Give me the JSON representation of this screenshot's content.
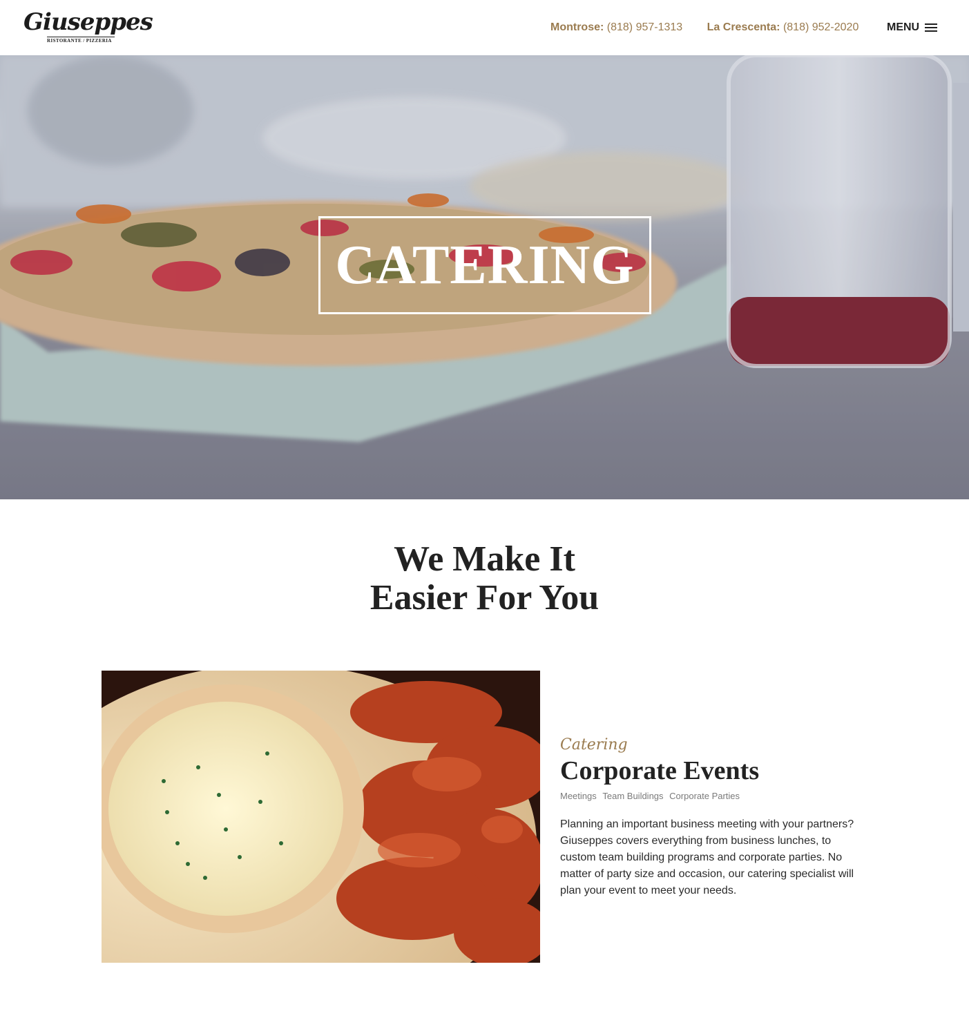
{
  "header": {
    "logo": {
      "name": "Giuseppes",
      "subtitle": "RISTORANTE / PIZZERIA"
    },
    "phones": [
      {
        "location": "Montrose:",
        "number": "(818) 957-1313"
      },
      {
        "location": "La Crescenta:",
        "number": "(818) 952-2020"
      }
    ],
    "menu_label": "MENU",
    "menu_icon": "hamburger-icon"
  },
  "hero": {
    "title": "CATERING"
  },
  "intro": {
    "line1": "We Make It",
    "line2": "Easier For You"
  },
  "feature": {
    "kicker": "Catering",
    "title": "Corporate Events",
    "tags": [
      "Meetings",
      "Team Buildings",
      "Corporate Parties"
    ],
    "body": "Planning an important business meeting with your partners? Giuseppes covers everything from business lunches, to custom team building programs and corporate parties. No matter of party size and occasion, our catering specialist will plan your event to meet your needs."
  },
  "colors": {
    "accent": "#9a7b4f",
    "text": "#222222",
    "muted": "#7a7a7a"
  }
}
